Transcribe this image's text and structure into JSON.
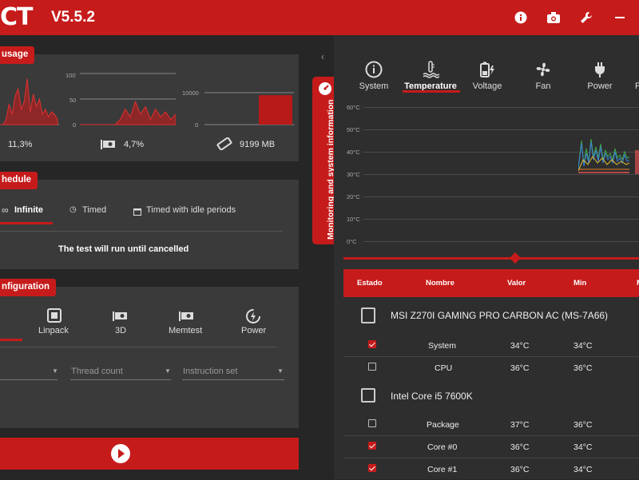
{
  "app": {
    "logo": "CT",
    "version": "V5.5.2"
  },
  "colors": {
    "accent": "#c61b1b",
    "panel": "#3a3a3a",
    "background": "#262626"
  },
  "titlebar_icons": [
    "info-icon",
    "camera-icon",
    "wrench-icon",
    "minimize-icon"
  ],
  "usage": {
    "label": "usage",
    "cpu": {
      "value": "11,3%",
      "axis": [],
      "series": [
        0,
        0,
        10,
        40,
        20,
        55,
        70,
        30,
        45,
        90,
        25,
        60,
        35,
        50,
        20,
        30,
        15,
        25,
        20,
        10
      ]
    },
    "gpu": {
      "value": "4,7%",
      "axis": [
        "100",
        "50",
        "0"
      ],
      "series": [
        0,
        0,
        0,
        0,
        0,
        0,
        0,
        0,
        10,
        30,
        15,
        45,
        20,
        35,
        10,
        30,
        15,
        25,
        10,
        20
      ]
    },
    "memory": {
      "value": "9199 MB",
      "axis": [
        "10000",
        "0"
      ],
      "fill": 0.92
    }
  },
  "schedule": {
    "label": "hedule",
    "tabs": [
      "Infinite",
      "Timed",
      "Timed with idle periods"
    ],
    "selected": "Infinite",
    "message": "The test will run until cancelled"
  },
  "configuration": {
    "label": "nfiguration",
    "tabs": [
      "Linpack",
      "3D",
      "Memtest",
      "Power"
    ],
    "fields": [
      {
        "placeholder": ""
      },
      {
        "placeholder": "Thread count"
      },
      {
        "placeholder": "Instruction set"
      }
    ]
  },
  "side_tab": {
    "label": "Monitoring and system information"
  },
  "monitor": {
    "tabs": [
      {
        "label": "System",
        "icon": "info-icon"
      },
      {
        "label": "Temperature",
        "icon": "thermometer-icon"
      },
      {
        "label": "Voltage",
        "icon": "battery-bolt-icon"
      },
      {
        "label": "Fan",
        "icon": "fan-icon"
      },
      {
        "label": "Power",
        "icon": "plug-icon"
      },
      {
        "label": "F",
        "icon": "more-icon"
      }
    ],
    "active_tab": "Temperature",
    "y_ticks": [
      "60°C",
      "50°C",
      "40°C",
      "30°C",
      "20°C",
      "10°C",
      "0°C"
    ],
    "table_headers": [
      "Estado",
      "Nombre",
      "Valor",
      "Min",
      "M"
    ],
    "devices": [
      {
        "name": "MSI Z270I GAMING PRO CARBON AC (MS-7A66)",
        "rows": [
          {
            "checked": true,
            "name": "System",
            "value": "34°C",
            "min": "34°C"
          },
          {
            "checked": false,
            "name": "CPU",
            "value": "36°C",
            "min": "36°C"
          }
        ]
      },
      {
        "name": "Intel Core i5 7600K",
        "rows": [
          {
            "checked": false,
            "name": "Package",
            "value": "37°C",
            "min": "36°C"
          },
          {
            "checked": true,
            "name": "Core #0",
            "value": "36°C",
            "min": "34°C"
          },
          {
            "checked": true,
            "name": "Core #1",
            "value": "36°C",
            "min": "34°C"
          }
        ]
      }
    ]
  }
}
